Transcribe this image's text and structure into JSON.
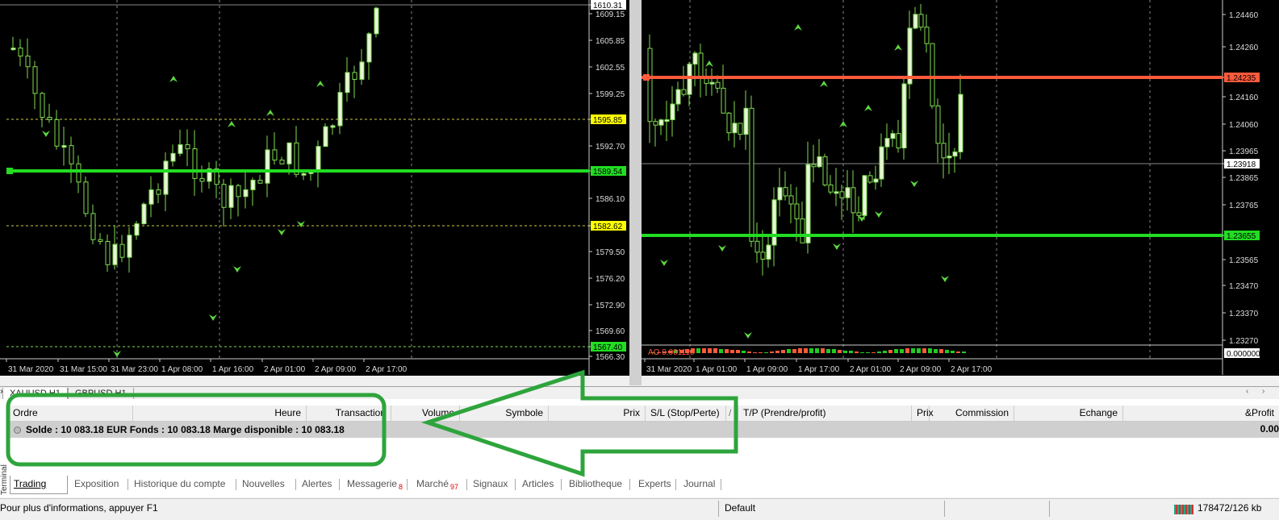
{
  "charts": {
    "left": {
      "symbol_tab": "XAUUSD,H1",
      "price_ticks": [
        "1610.31",
        "1609.15",
        "1605.85",
        "1602.55",
        "1599.25",
        "1595.85",
        "1592.70",
        "1589.54",
        "1586.10",
        "1582.62",
        "1579.50",
        "1576.20",
        "1572.90",
        "1569.60",
        "1567.40",
        "1566.30"
      ],
      "time_ticks": [
        "31 Mar 2020",
        "31 Mar 15:00",
        "31 Mar 23:00",
        "1 Apr 08:00",
        "1 Apr 16:00",
        "2 Apr 01:00",
        "2 Apr 09:00",
        "2 Apr 17:00"
      ],
      "levels": {
        "green_line": "1589.54",
        "yellow_upper": "1595.85",
        "yellow_lower": "1582.62",
        "bottom_label": "1567.40",
        "top_label": "1610.31"
      },
      "colors": {
        "background": "#000000",
        "bull": "#e8f5d8",
        "bear": "#000000",
        "wick": "#7fdd50",
        "support_line": "#22dd22",
        "label_yellow": "#ffff00"
      }
    },
    "right": {
      "symbol_tab": "GBPUSD,H1",
      "price_ticks": [
        "1.24460",
        "1.24260",
        "1.24235",
        "1.24160",
        "1.24060",
        "1.23965",
        "1.23918",
        "1.23865",
        "1.23765",
        "1.23655",
        "1.23565",
        "1.23470",
        "1.23370",
        "1.23270"
      ],
      "time_ticks": [
        "31 Mar 2020",
        "1 Apr 01:00",
        "1 Apr 09:00",
        "1 Apr 17:00",
        "2 Apr 01:00",
        "2 Apr 09:00",
        "2 Apr 17:00"
      ],
      "levels": {
        "red_line": "1.24235",
        "green_line": "1.23655",
        "white_label": "1.23918"
      },
      "indicator": {
        "label": "AO 0.001110",
        "value": "0.000000"
      },
      "colors": {
        "resistance_line": "#ff5a3c",
        "support_line": "#22dd22",
        "ao_up": "#22cc22",
        "ao_down": "#ff5a3c"
      }
    }
  },
  "terminal": {
    "side_label": "Terminal",
    "columns": [
      "Ordre",
      "Heure",
      "Transaction",
      "Volume",
      "Symbole",
      "Prix",
      "S/L (Stop/Perte)",
      "/",
      "T/P (Prendre/profit)",
      "Prix",
      "Commission",
      "Echange",
      "&Profit"
    ],
    "balance_text": "Solde : 10 083.18 EUR  Fonds : 10 083.18  Marge disponible : 10 083.18",
    "profit_total": "0.00",
    "tabs": [
      {
        "label": "Trading",
        "active": true
      },
      {
        "label": "Exposition"
      },
      {
        "label": "Historique du compte"
      },
      {
        "label": "Nouvelles"
      },
      {
        "label": "Alertes"
      },
      {
        "label": "Messagerie",
        "count": "8"
      },
      {
        "label": "Marché",
        "count": "97"
      },
      {
        "label": "Signaux"
      },
      {
        "label": "Articles"
      },
      {
        "label": "Bibliotheque"
      },
      {
        "label": "Experts"
      },
      {
        "label": "Journal"
      }
    ]
  },
  "status": {
    "help": "Pour plus d'informations, appuyer F1",
    "profile": "Default",
    "traffic": "178472/126 kb"
  },
  "annotation": {
    "color": "#2ea43c"
  }
}
